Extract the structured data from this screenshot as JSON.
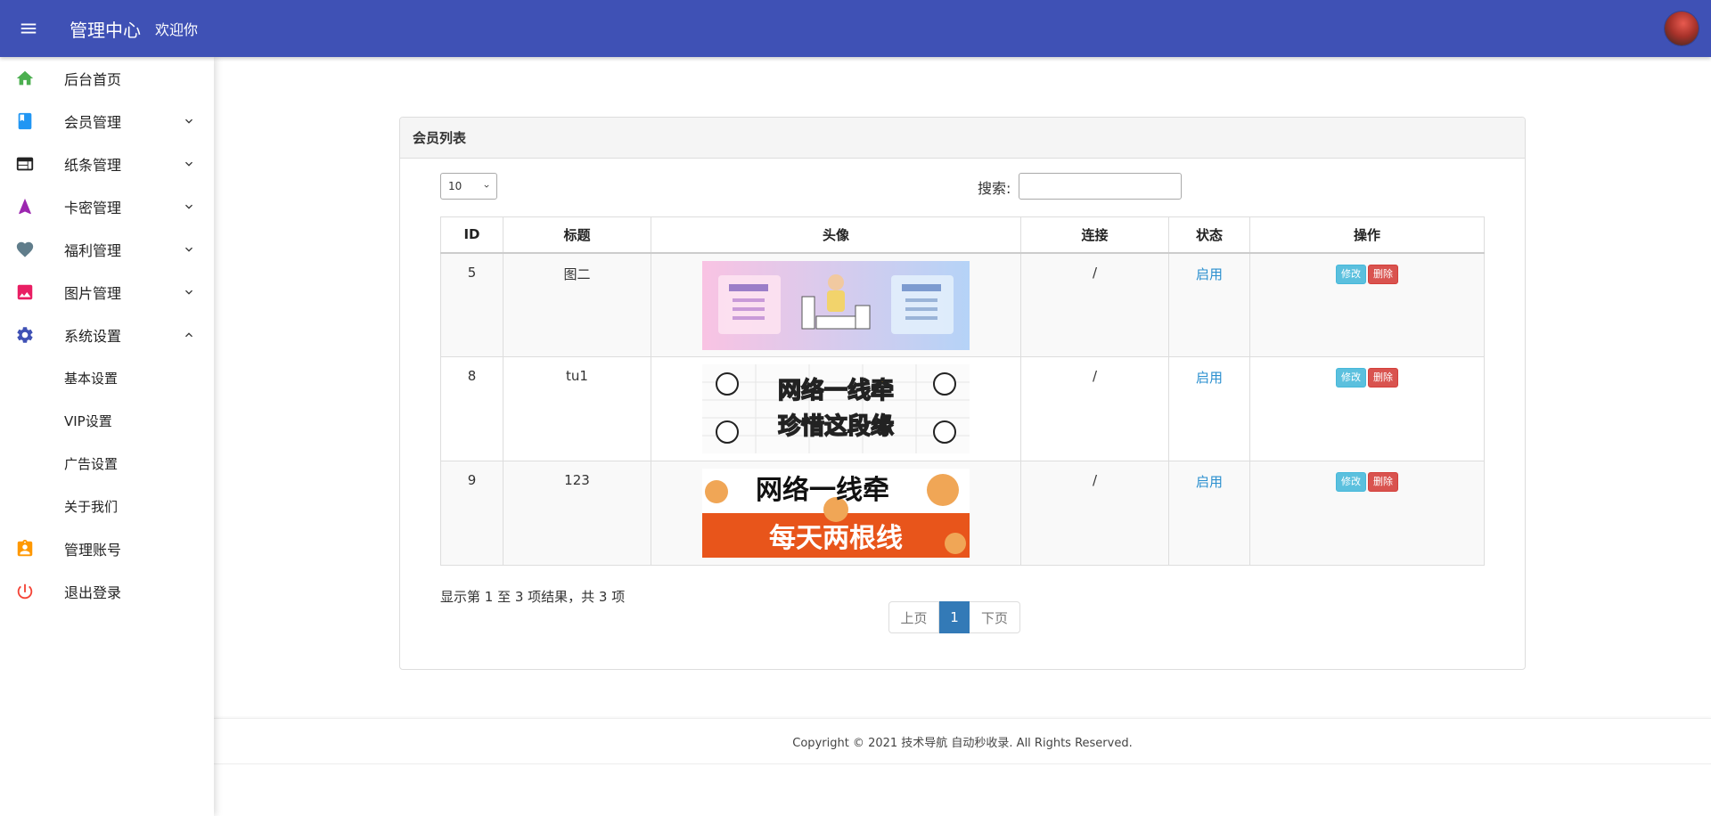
{
  "header": {
    "brand": "管理中心",
    "welcome": "欢迎你"
  },
  "sidebar": {
    "items": [
      {
        "label": "后台首页",
        "icon": "home-icon",
        "color": "#4caf50"
      },
      {
        "label": "会员管理",
        "icon": "book-icon",
        "color": "#2196f3"
      },
      {
        "label": "纸条管理",
        "icon": "web-icon",
        "color": "#222222"
      },
      {
        "label": "卡密管理",
        "icon": "navigation-icon",
        "color": "#9c27b0"
      },
      {
        "label": "福利管理",
        "icon": "heart-icon",
        "color": "#607d8b"
      },
      {
        "label": "图片管理",
        "icon": "image-icon",
        "color": "#e91e63"
      },
      {
        "label": "系统设置",
        "icon": "gear-icon",
        "color": "#3f51b5"
      },
      {
        "label": "管理账号",
        "icon": "account-box-icon",
        "color": "#ff9800"
      },
      {
        "label": "退出登录",
        "icon": "power-icon",
        "color": "#f44336"
      }
    ],
    "sub_items": [
      "基本设置",
      "VIP设置",
      "广告设置",
      "关于我们"
    ]
  },
  "panel": {
    "title": "会员列表",
    "length_value": "10",
    "search_label": "搜索:",
    "columns": [
      "ID",
      "标题",
      "头像",
      "连接",
      "状态",
      "操作"
    ],
    "rows": [
      {
        "id": "5",
        "title": "图二",
        "link": "/",
        "status": "启用",
        "thumb": "banner-pink-icon",
        "edit": "修改",
        "del": "删除"
      },
      {
        "id": "8",
        "title": "tu1",
        "link": "/",
        "status": "启用",
        "thumb": "banner-sketch-icon",
        "edit": "修改",
        "del": "删除"
      },
      {
        "id": "9",
        "title": "123",
        "link": "/",
        "status": "启用",
        "thumb": "banner-dog-icon",
        "edit": "修改",
        "del": "删除"
      }
    ],
    "thumb_texts": {
      "sketch_line1": "网络一线牵",
      "sketch_line2": "珍惜这段缘",
      "dog_line1": "网络一线牵",
      "dog_line2": "每天两根线"
    },
    "info": "显示第 1 至 3 项结果，共 3 项",
    "pager": {
      "prev": "上页",
      "current": "1",
      "next": "下页"
    }
  },
  "footer": {
    "copyright": "Copyright © 2021 技术导航 自动秒收录. All Rights Reserved."
  }
}
